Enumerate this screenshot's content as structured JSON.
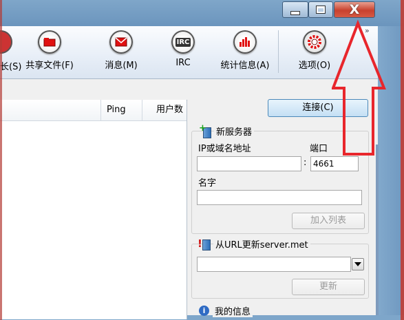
{
  "window": {
    "min_glyph": "",
    "close_glyph": "X"
  },
  "toolbar": {
    "partial_label": "长(S)",
    "share_label": "共享文件(F)",
    "messages_label": "消息(M)",
    "irc_label": "IRC",
    "irc_icon_text": "IRC",
    "stats_label": "统计信息(A)",
    "options_label": "选项(O)",
    "more": "»"
  },
  "server_list": {
    "columns": [
      "Ping",
      "用户数"
    ]
  },
  "new_server": {
    "connect_label": "连接(C)",
    "title": "新服务器",
    "ip_label": "IP或域名地址",
    "port_label": "端口",
    "colon": ":",
    "ip_value": "",
    "port_value": "4661",
    "name_label": "名字",
    "name_value": "",
    "add_label": "加入列表"
  },
  "update": {
    "title": "从URL更新server.met",
    "url_value": "",
    "update_label": "更新"
  },
  "my_info": {
    "title": "我的信息"
  },
  "colors": {
    "annotation_red": "#e8262c",
    "accent_blue": "#4b88b8"
  }
}
